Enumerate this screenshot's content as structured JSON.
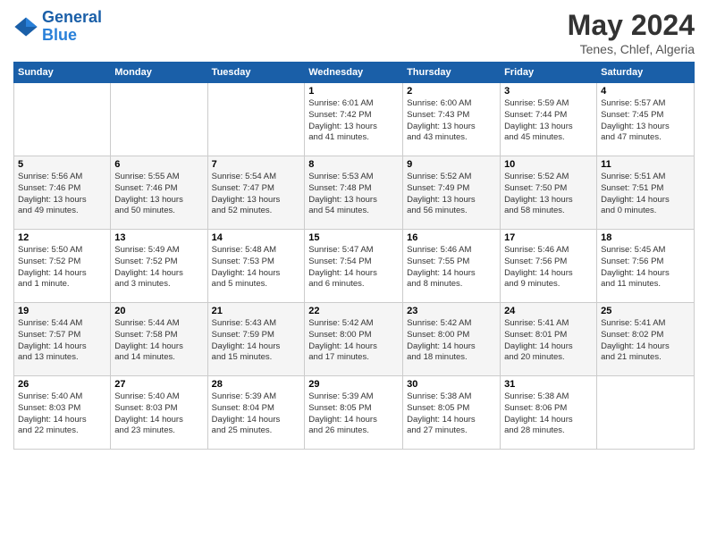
{
  "header": {
    "logo_line1": "General",
    "logo_line2": "Blue",
    "month_title": "May 2024",
    "location": "Tenes, Chlef, Algeria"
  },
  "days_of_week": [
    "Sunday",
    "Monday",
    "Tuesday",
    "Wednesday",
    "Thursday",
    "Friday",
    "Saturday"
  ],
  "weeks": [
    [
      {
        "day": "",
        "info": ""
      },
      {
        "day": "",
        "info": ""
      },
      {
        "day": "",
        "info": ""
      },
      {
        "day": "1",
        "info": "Sunrise: 6:01 AM\nSunset: 7:42 PM\nDaylight: 13 hours\nand 41 minutes."
      },
      {
        "day": "2",
        "info": "Sunrise: 6:00 AM\nSunset: 7:43 PM\nDaylight: 13 hours\nand 43 minutes."
      },
      {
        "day": "3",
        "info": "Sunrise: 5:59 AM\nSunset: 7:44 PM\nDaylight: 13 hours\nand 45 minutes."
      },
      {
        "day": "4",
        "info": "Sunrise: 5:57 AM\nSunset: 7:45 PM\nDaylight: 13 hours\nand 47 minutes."
      }
    ],
    [
      {
        "day": "5",
        "info": "Sunrise: 5:56 AM\nSunset: 7:46 PM\nDaylight: 13 hours\nand 49 minutes."
      },
      {
        "day": "6",
        "info": "Sunrise: 5:55 AM\nSunset: 7:46 PM\nDaylight: 13 hours\nand 50 minutes."
      },
      {
        "day": "7",
        "info": "Sunrise: 5:54 AM\nSunset: 7:47 PM\nDaylight: 13 hours\nand 52 minutes."
      },
      {
        "day": "8",
        "info": "Sunrise: 5:53 AM\nSunset: 7:48 PM\nDaylight: 13 hours\nand 54 minutes."
      },
      {
        "day": "9",
        "info": "Sunrise: 5:52 AM\nSunset: 7:49 PM\nDaylight: 13 hours\nand 56 minutes."
      },
      {
        "day": "10",
        "info": "Sunrise: 5:52 AM\nSunset: 7:50 PM\nDaylight: 13 hours\nand 58 minutes."
      },
      {
        "day": "11",
        "info": "Sunrise: 5:51 AM\nSunset: 7:51 PM\nDaylight: 14 hours\nand 0 minutes."
      }
    ],
    [
      {
        "day": "12",
        "info": "Sunrise: 5:50 AM\nSunset: 7:52 PM\nDaylight: 14 hours\nand 1 minute."
      },
      {
        "day": "13",
        "info": "Sunrise: 5:49 AM\nSunset: 7:52 PM\nDaylight: 14 hours\nand 3 minutes."
      },
      {
        "day": "14",
        "info": "Sunrise: 5:48 AM\nSunset: 7:53 PM\nDaylight: 14 hours\nand 5 minutes."
      },
      {
        "day": "15",
        "info": "Sunrise: 5:47 AM\nSunset: 7:54 PM\nDaylight: 14 hours\nand 6 minutes."
      },
      {
        "day": "16",
        "info": "Sunrise: 5:46 AM\nSunset: 7:55 PM\nDaylight: 14 hours\nand 8 minutes."
      },
      {
        "day": "17",
        "info": "Sunrise: 5:46 AM\nSunset: 7:56 PM\nDaylight: 14 hours\nand 9 minutes."
      },
      {
        "day": "18",
        "info": "Sunrise: 5:45 AM\nSunset: 7:56 PM\nDaylight: 14 hours\nand 11 minutes."
      }
    ],
    [
      {
        "day": "19",
        "info": "Sunrise: 5:44 AM\nSunset: 7:57 PM\nDaylight: 14 hours\nand 13 minutes."
      },
      {
        "day": "20",
        "info": "Sunrise: 5:44 AM\nSunset: 7:58 PM\nDaylight: 14 hours\nand 14 minutes."
      },
      {
        "day": "21",
        "info": "Sunrise: 5:43 AM\nSunset: 7:59 PM\nDaylight: 14 hours\nand 15 minutes."
      },
      {
        "day": "22",
        "info": "Sunrise: 5:42 AM\nSunset: 8:00 PM\nDaylight: 14 hours\nand 17 minutes."
      },
      {
        "day": "23",
        "info": "Sunrise: 5:42 AM\nSunset: 8:00 PM\nDaylight: 14 hours\nand 18 minutes."
      },
      {
        "day": "24",
        "info": "Sunrise: 5:41 AM\nSunset: 8:01 PM\nDaylight: 14 hours\nand 20 minutes."
      },
      {
        "day": "25",
        "info": "Sunrise: 5:41 AM\nSunset: 8:02 PM\nDaylight: 14 hours\nand 21 minutes."
      }
    ],
    [
      {
        "day": "26",
        "info": "Sunrise: 5:40 AM\nSunset: 8:03 PM\nDaylight: 14 hours\nand 22 minutes."
      },
      {
        "day": "27",
        "info": "Sunrise: 5:40 AM\nSunset: 8:03 PM\nDaylight: 14 hours\nand 23 minutes."
      },
      {
        "day": "28",
        "info": "Sunrise: 5:39 AM\nSunset: 8:04 PM\nDaylight: 14 hours\nand 25 minutes."
      },
      {
        "day": "29",
        "info": "Sunrise: 5:39 AM\nSunset: 8:05 PM\nDaylight: 14 hours\nand 26 minutes."
      },
      {
        "day": "30",
        "info": "Sunrise: 5:38 AM\nSunset: 8:05 PM\nDaylight: 14 hours\nand 27 minutes."
      },
      {
        "day": "31",
        "info": "Sunrise: 5:38 AM\nSunset: 8:06 PM\nDaylight: 14 hours\nand 28 minutes."
      },
      {
        "day": "",
        "info": ""
      }
    ]
  ]
}
